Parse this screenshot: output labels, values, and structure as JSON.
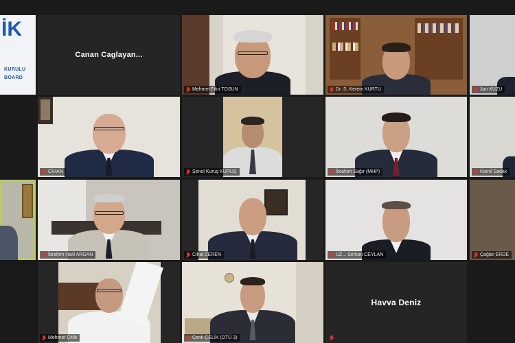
{
  "participants": [
    {
      "name": "Canan Caglayan..."
    },
    {
      "name": "Mehmet Fikri TOSUN"
    },
    {
      "name": "Dr. S. Kerem KURTU"
    },
    {
      "name": "Jan KUZU"
    },
    {
      "name": "CİHAN"
    },
    {
      "name": "Şenol Kuruş  KURUŞ"
    },
    {
      "name": "İbrahim Sağır (MHP)"
    },
    {
      "name": "Kamil Sadak"
    },
    {
      "name": "İbrahim Halil ARGAN"
    },
    {
      "name": "Cihat ZEREN"
    },
    {
      "name": "UZ... Serkan CEYLAN"
    },
    {
      "name": "Çağlar ERDE"
    },
    {
      "name": "Mehmet Çitlik"
    },
    {
      "name": "Cenk ÇELİK (DTÜ 3)"
    },
    {
      "name": "Havva Deniz"
    }
  ],
  "logo": {
    "mark": "İK",
    "line1": "KURULU",
    "line2": "BOARD"
  }
}
